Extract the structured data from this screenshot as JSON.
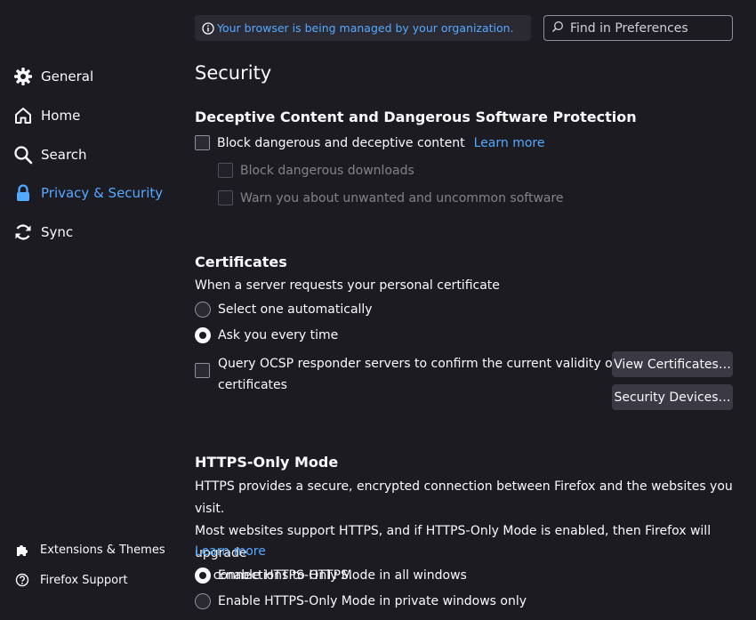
{
  "policy_notice": "Your browser is being managed by your organization.",
  "search": {
    "placeholder": "Find in Preferences"
  },
  "sidebar": {
    "items": [
      {
        "label": "General",
        "icon": "gear-icon"
      },
      {
        "label": "Home",
        "icon": "home-icon"
      },
      {
        "label": "Search",
        "icon": "search-icon"
      },
      {
        "label": "Privacy & Security",
        "icon": "lock-icon",
        "active": true
      },
      {
        "label": "Sync",
        "icon": "sync-icon"
      }
    ],
    "footer": [
      {
        "label": "Extensions & Themes",
        "icon": "puzzle-icon"
      },
      {
        "label": "Firefox Support",
        "icon": "help-icon"
      }
    ]
  },
  "page_title": "Security",
  "deceptive": {
    "heading": "Deceptive Content and Dangerous Software Protection",
    "block_label": "Block dangerous and deceptive content",
    "learn_more": "Learn more",
    "downloads_label": "Block dangerous downloads",
    "warn_label": "Warn you about unwanted and uncommon software"
  },
  "certificates": {
    "heading": "Certificates",
    "intro": "When a server requests your personal certificate",
    "option_auto": "Select one automatically",
    "option_ask": "Ask you every time",
    "ocsp_line1": "Query OCSP responder servers to confirm the current validity of",
    "ocsp_line2": "certificates",
    "view_button": "View Certificates…",
    "devices_button": "Security Devices…"
  },
  "https_only": {
    "heading": "HTTPS-Only Mode",
    "line1": "HTTPS provides a secure, encrypted connection between Firefox and the websites you visit.",
    "line2": "Most websites support HTTPS, and if HTTPS-Only Mode is enabled, then Firefox will upgrade",
    "line3": "all connections to HTTPS.",
    "learn_more": "Learn more",
    "option_all": "Enable HTTPS-Only Mode in all windows",
    "option_private": "Enable HTTPS-Only Mode in private windows only"
  },
  "colors": {
    "accent": "#54a9ff",
    "background": "#1c1b22",
    "surface": "#2b2a33"
  }
}
